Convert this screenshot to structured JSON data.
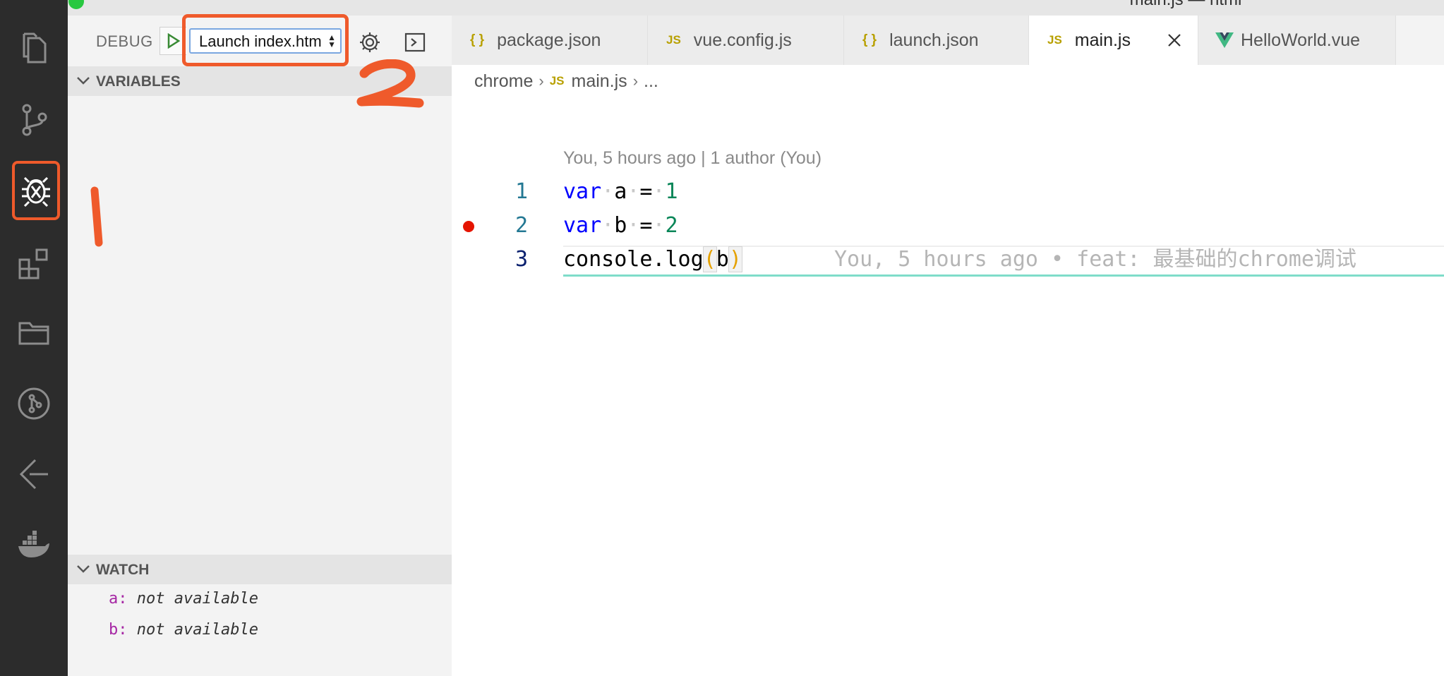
{
  "window": {
    "title": "main.js — html"
  },
  "activity_bar": {
    "items": [
      {
        "name": "explorer",
        "icon": "files-icon"
      },
      {
        "name": "source-control",
        "icon": "source-control-icon"
      },
      {
        "name": "debug",
        "icon": "debug-icon",
        "active": true
      },
      {
        "name": "extensions",
        "icon": "extensions-icon"
      },
      {
        "name": "project-manager",
        "icon": "folders-icon"
      },
      {
        "name": "git-graph",
        "icon": "git-icon"
      },
      {
        "name": "gitlens",
        "icon": "gitlens-icon"
      },
      {
        "name": "docker",
        "icon": "docker-icon"
      }
    ]
  },
  "debug": {
    "label": "DEBUG",
    "config": "Launch index.htm",
    "variables_header": "VARIABLES",
    "watch_header": "WATCH",
    "watch": [
      {
        "name": "a:",
        "value": "not available"
      },
      {
        "name": "b:",
        "value": "not available"
      }
    ]
  },
  "tabs": [
    {
      "label": "package.json",
      "icon": "{ }"
    },
    {
      "label": "vue.config.js",
      "icon": "JS"
    },
    {
      "label": "launch.json",
      "icon": "{ }"
    },
    {
      "label": "main.js",
      "icon": "JS",
      "active": true
    },
    {
      "label": "HelloWorld.vue",
      "icon": "V"
    }
  ],
  "breadcrumb": {
    "folder": "chrome",
    "file_icon": "JS",
    "file": "main.js",
    "more": "..."
  },
  "editor": {
    "codelens": "You, 5 hours ago | 1 author (You)",
    "lines": [
      {
        "number": "1",
        "kw": "var",
        "name": "a",
        "op": "=",
        "value": "1"
      },
      {
        "number": "2",
        "kw": "var",
        "name": "b",
        "op": "=",
        "value": "2",
        "breakpoint": true
      },
      {
        "number": "3",
        "call": "console.log",
        "open": "(",
        "arg": "b",
        "close": ")"
      }
    ],
    "blame": "You, 5 hours ago • feat: 最基础的chrome调试"
  },
  "annotations": {
    "first": "1",
    "second": "2"
  },
  "colors": {
    "annotation": "#ef5a2b",
    "breakpoint": "#e51400",
    "keyword": "#0000ff",
    "number": "#098658",
    "current_line_underline": "#7fdcc9"
  }
}
